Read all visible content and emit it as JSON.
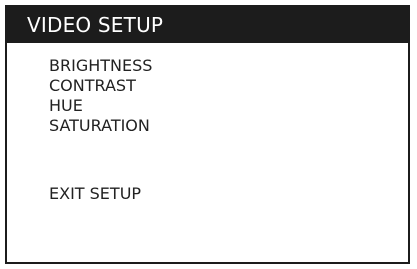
{
  "window": {
    "title": "VIDEO SETUP"
  },
  "menu": {
    "items": [
      {
        "label": "BRIGHTNESS"
      },
      {
        "label": "CONTRAST"
      },
      {
        "label": "HUE"
      },
      {
        "label": "SATURATION"
      }
    ],
    "exit_label": "EXIT SETUP"
  },
  "colors": {
    "title_background": "#1c1c1c",
    "title_text": "#ffffff",
    "panel_background": "#ffffff",
    "menu_text": "#222222",
    "border": "#1c1c1c"
  }
}
